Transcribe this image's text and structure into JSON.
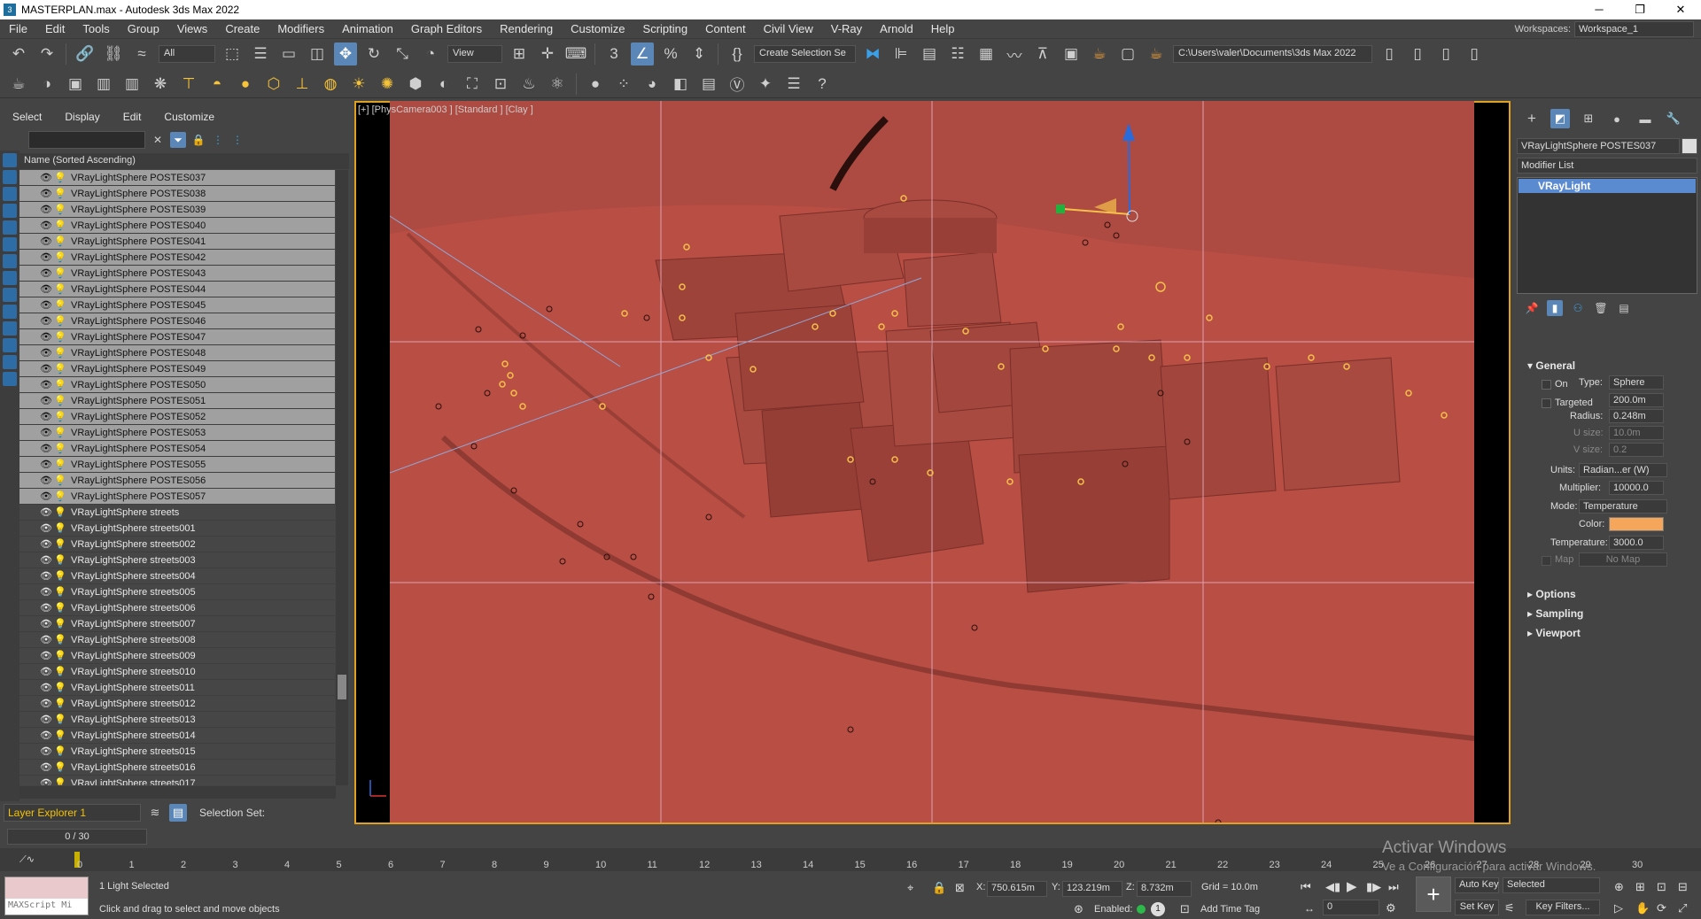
{
  "window": {
    "title": "MASTERPLAN.max - Autodesk 3ds Max 2022"
  },
  "menu": [
    "File",
    "Edit",
    "Tools",
    "Group",
    "Views",
    "Create",
    "Modifiers",
    "Animation",
    "Graph Editors",
    "Rendering",
    "Customize",
    "Scripting",
    "Content",
    "Civil View",
    "V-Ray",
    "Arnold",
    "Help"
  ],
  "workspace": {
    "label": "Workspaces:",
    "value": "Workspace_1"
  },
  "toolbar": {
    "filter_value": "All",
    "refcoord_value": "View",
    "selection_set_value": "Create Selection Se",
    "project_path": "C:\\Users\\valer\\Documents\\3ds Max 2022"
  },
  "scene_explorer": {
    "menu": [
      "Select",
      "Display",
      "Edit",
      "Customize"
    ],
    "column_header": "Name (Sorted Ascending)",
    "objects": [
      "VRayLightSphere POSTES037",
      "VRayLightSphere POSTES038",
      "VRayLightSphere POSTES039",
      "VRayLightSphere POSTES040",
      "VRayLightSphere POSTES041",
      "VRayLightSphere POSTES042",
      "VRayLightSphere POSTES043",
      "VRayLightSphere POSTES044",
      "VRayLightSphere POSTES045",
      "VRayLightSphere POSTES046",
      "VRayLightSphere POSTES047",
      "VRayLightSphere POSTES048",
      "VRayLightSphere POSTES049",
      "VRayLightSphere POSTES050",
      "VRayLightSphere POSTES051",
      "VRayLightSphere POSTES052",
      "VRayLightSphere POSTES053",
      "VRayLightSphere POSTES054",
      "VRayLightSphere POSTES055",
      "VRayLightSphere POSTES056",
      "VRayLightSphere POSTES057",
      "VRayLightSphere streets",
      "VRayLightSphere streets001",
      "VRayLightSphere streets002",
      "VRayLightSphere streets003",
      "VRayLightSphere streets004",
      "VRayLightSphere streets005",
      "VRayLightSphere streets006",
      "VRayLightSphere streets007",
      "VRayLightSphere streets008",
      "VRayLightSphere streets009",
      "VRayLightSphere streets010",
      "VRayLightSphere streets011",
      "VRayLightSphere streets012",
      "VRayLightSphere streets013",
      "VRayLightSphere streets014",
      "VRayLightSphere streets015",
      "VRayLightSphere streets016",
      "VRayLightSphere streets017"
    ],
    "layer_explorer": "Layer Explorer 1",
    "selection_set_label": "Selection Set:"
  },
  "viewport": {
    "label": "[+] [PhysCamera003 ] [Standard ] [Clay ]"
  },
  "command_panel": {
    "object_name": "VRayLightSphere POSTES037",
    "modifier_list": "Modifier List",
    "stack_item": "VRayLight",
    "general": {
      "title": "General",
      "on_label": "On",
      "type_label": "Type:",
      "type_value": "Sphere",
      "targeted_label": "Targeted",
      "targeted_value": "200.0m",
      "radius_label": "Radius:",
      "radius_value": "0.248m",
      "usize_label": "U size:",
      "usize_value": "10.0m",
      "vsize_label": "V size:",
      "vsize_value": "0.2",
      "units_label": "Units:",
      "units_value": "Radian...er (W)",
      "multiplier_label": "Multiplier:",
      "multiplier_value": "10000.0",
      "mode_label": "Mode:",
      "mode_value": "Temperature",
      "color_label": "Color:",
      "color_hex": "#f5a65b",
      "temperature_label": "Temperature:",
      "temperature_value": "3000.0",
      "map_label": "Map",
      "map_value": "No Map"
    },
    "rollouts": [
      "Options",
      "Sampling",
      "Viewport"
    ]
  },
  "timeline": {
    "frame_display": "0 / 30",
    "ticks": [
      "0",
      "1",
      "2",
      "3",
      "4",
      "5",
      "6",
      "7",
      "8",
      "9",
      "10",
      "11",
      "12",
      "13",
      "14",
      "15",
      "16",
      "17",
      "18",
      "19",
      "20",
      "21",
      "22",
      "23",
      "24",
      "25",
      "26",
      "27",
      "28",
      "29",
      "30"
    ]
  },
  "status": {
    "maxscript": "MAXScript Mi",
    "selection": "1 Light Selected",
    "prompt": "Click and drag to select and move objects",
    "x": "750.615m",
    "y": "123.219m",
    "z": "8.732m",
    "grid": "Grid = 10.0m",
    "enabled_label": "Enabled:",
    "add_time_tag": "Add Time Tag",
    "auto_key": "Auto Key",
    "set_key": "Set Key",
    "key_mode": "Selected",
    "key_filters": "Key Filters...",
    "frame_input": "0"
  },
  "watermark": {
    "line1": "Activar Windows",
    "line2": "Ve a Configuración para activar Windows."
  }
}
